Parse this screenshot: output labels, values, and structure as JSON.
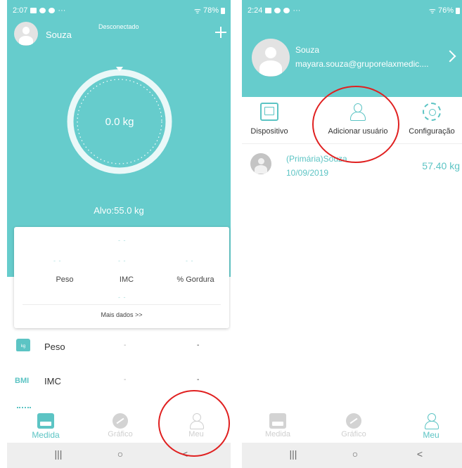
{
  "left": {
    "status": {
      "time": "2:07",
      "battery": "78%"
    },
    "header": {
      "username": "Souza",
      "connection": "Desconectado"
    },
    "gauge": {
      "weight": "0.0 kg",
      "target": "Alvo:55.0 kg"
    },
    "card": {
      "dash": "- -",
      "metrics": [
        "Peso",
        "IMC",
        "% Gordura"
      ],
      "more": "Mais dados >>"
    },
    "rows": [
      {
        "icon": "kg",
        "label": "Peso",
        "value1": "-",
        "value2": "-"
      },
      {
        "icon": "BMI",
        "label": "IMC",
        "value1": "-",
        "value2": "-"
      }
    ],
    "nav": {
      "measure": "Medida",
      "chart": "Gráfico",
      "me": "Meu"
    }
  },
  "right": {
    "status": {
      "time": "2:24",
      "battery": "76%"
    },
    "profile": {
      "name": "Souza",
      "email": "mayara.souza@gruporelaxmedic...."
    },
    "tabs": {
      "device": "Dispositivo",
      "add_user": "Adicionar usuário",
      "settings": "Configuração"
    },
    "member": {
      "name": "(Primária)Souza",
      "date": "10/09/2019",
      "weight": "57.40 kg"
    },
    "nav": {
      "measure": "Medida",
      "chart": "Gráfico",
      "me": "Meu"
    }
  },
  "sysnav": {
    "recent": "|||",
    "home": "○",
    "back": "<"
  },
  "colors": {
    "accent": "#66cccc",
    "highlight": "#e02020"
  }
}
